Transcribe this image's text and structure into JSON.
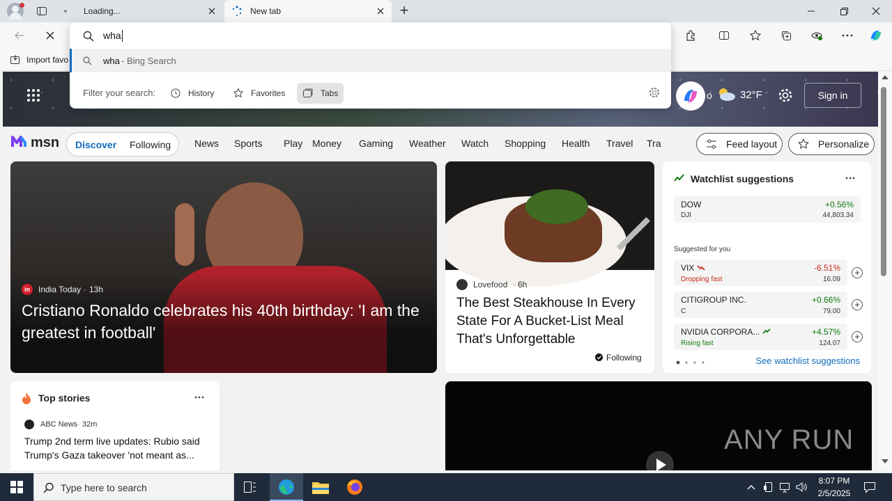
{
  "tabs": [
    {
      "title": "Loading..."
    },
    {
      "title": "New tab"
    }
  ],
  "toolbar": {
    "new_tab_symbol": "+"
  },
  "omnibox": {
    "query": "wha",
    "suggestion_query": "wha",
    "suggestion_suffix": " - Bing Search",
    "filter_label": "Filter your search:",
    "filters": [
      "History",
      "Favorites",
      "Tabs"
    ]
  },
  "favorites_bar": {
    "import_label": "Import favo"
  },
  "hero": {
    "weather_temp": "32°F",
    "sign_in": "Sign in",
    "weather_partial": "o"
  },
  "msn": {
    "brand": "msn",
    "tabs": [
      "Discover",
      "Following"
    ],
    "nav": [
      "News",
      "Sports",
      "Play",
      "Money",
      "Gaming",
      "Weather",
      "Watch",
      "Shopping",
      "Health",
      "Travel",
      "Tra"
    ],
    "feed_layout": "Feed layout",
    "personalize": "Personalize"
  },
  "main_story": {
    "source": "India Today",
    "time": "13h",
    "headline": "Cristiano Ronaldo celebrates his 40th birthday: 'I am the greatest in football'"
  },
  "food_story": {
    "source": "Lovefood",
    "time": "6h",
    "headline": "The Best Steakhouse In Every State For A Bucket-List Meal That's Unforgettable",
    "following": "Following"
  },
  "watchlist": {
    "title": "Watchlist suggestions",
    "suggested_label": "Suggested for you",
    "see_more": "See watchlist suggestions",
    "dow": {
      "name": "DOW",
      "sub": "DJI",
      "change": "+0.56%",
      "value": "44,803.34"
    },
    "items": [
      {
        "name": "VIX",
        "sub": "Dropping fast",
        "change": "-6.51%",
        "value": "16.09",
        "change_color": "#c42b1c",
        "sub_color": "#c42b1c"
      },
      {
        "name": "CITIGROUP INC.",
        "sub": "C",
        "change": "+0.66%",
        "value": "79.00",
        "change_color": "#0f7b0f",
        "sub_color": "#333333"
      },
      {
        "name": "NVIDIA CORPORA...",
        "sub": "Rising fast",
        "change": "+4.57%",
        "value": "124.07",
        "change_color": "#0f7b0f",
        "sub_color": "#0f7b0f"
      }
    ]
  },
  "top_stories": {
    "title": "Top stories",
    "source": "ABC News",
    "time": "32m",
    "headline": "Trump 2nd term live updates: Rubio said Trump's Gaza takeover 'not meant as..."
  },
  "video": {
    "watermark": "ANY RUN"
  },
  "taskbar": {
    "search_placeholder": "Type here to search",
    "time": "8:07 PM",
    "date": "2/5/2025"
  },
  "colors": {
    "accent": "#0f6cbd",
    "positive": "#0f7b0f",
    "negative": "#c42b1c"
  }
}
